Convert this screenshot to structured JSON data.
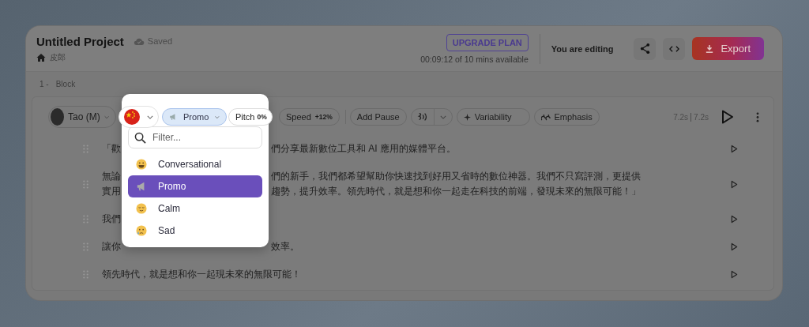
{
  "project": {
    "title": "Untitled Project",
    "save_status": "Saved",
    "breadcrumb": "皮郎"
  },
  "plan": {
    "upgrade_button": "UPGRADE PLAN",
    "usage": "00:09:12 of 10 mins available"
  },
  "editing_status": "You are editing",
  "export_button": "Export",
  "block": {
    "number": "1 -",
    "label": "Block",
    "voice": "Tao (M)",
    "style_chip": "Promo",
    "pitch": {
      "label": "Pitch",
      "value": "0%"
    },
    "speed": {
      "label": "Speed",
      "value": "+12%"
    },
    "add_pause": "Add Pause",
    "variability": "Variability",
    "emphasis": "Emphasis",
    "durations": [
      "7.2s",
      "7.2s"
    ],
    "paragraphs": [
      {
        "lines": [
          {
            "kind": "split",
            "before": "「歡",
            "after": "們分享最新數位工具和 AI 應用的媒體平台。"
          }
        ]
      },
      {
        "lines": [
          {
            "kind": "split",
            "before": "無論",
            "after": "們的新手，我們都希望幫助你快速找到好用又省時的數位神器。我們不只寫評測，更提供"
          },
          {
            "kind": "split",
            "before": "實用",
            "after": "趨勢，提升效率。領先時代，就是想和你一起走在科技的前端，發現未來的無限可能！」"
          }
        ]
      },
      {
        "lines": [
          {
            "kind": "split",
            "before": "我們"
          }
        ]
      },
      {
        "lines": [
          {
            "kind": "split",
            "before": "讓你",
            "after": "效率。"
          }
        ]
      },
      {
        "lines": [
          {
            "kind": "full",
            "before": "領先時代，就是想和你一起現未來的無限可能！"
          }
        ]
      }
    ]
  },
  "style_menu": {
    "placeholder": "Filter...",
    "options": [
      {
        "label": "Conversational",
        "kind": "grin",
        "selected": false
      },
      {
        "label": "Promo",
        "kind": "megaphone",
        "selected": true
      },
      {
        "label": "Calm",
        "kind": "relieved",
        "selected": false
      },
      {
        "label": "Sad",
        "kind": "crying",
        "selected": false
      }
    ]
  }
}
